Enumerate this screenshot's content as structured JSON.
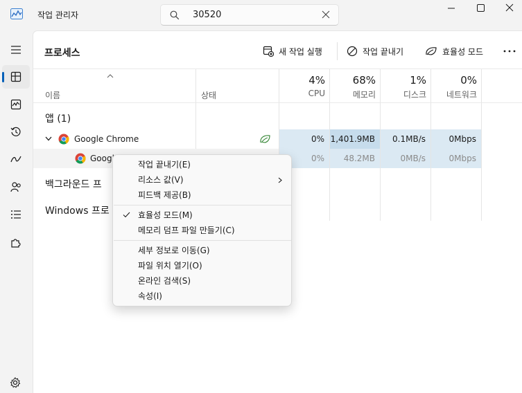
{
  "window": {
    "title": "작업 관리자",
    "search_value": "30520"
  },
  "page": {
    "title": "프로세스"
  },
  "toolbar": {
    "run_new_task": "새 작업 실행",
    "end_task": "작업 끝내기",
    "efficiency_mode": "효율성 모드"
  },
  "columns": {
    "name": "이름",
    "status": "상태",
    "cpu": {
      "percent": "4%",
      "label": "CPU"
    },
    "memory": {
      "percent": "68%",
      "label": "메모리"
    },
    "disk": {
      "percent": "1%",
      "label": "디스크"
    },
    "network": {
      "percent": "0%",
      "label": "네트워크"
    }
  },
  "groups": {
    "apps": "앱 (1)",
    "background": "백그라운드 프",
    "windows": "Windows 프로"
  },
  "rows": [
    {
      "name": "Google Chrome",
      "cpu": "0%",
      "memory": "1,401.9MB",
      "disk": "0.1MB/s",
      "network": "0Mbps"
    },
    {
      "name": "Googl",
      "cpu": "0%",
      "memory": "48.2MB",
      "disk": "0MB/s",
      "network": "0Mbps"
    }
  ],
  "context_menu": {
    "end_task": "작업 끝내기(E)",
    "resource_values": "리소스 값(V)",
    "feedback": "피드백 제공(B)",
    "efficiency_mode": "효율성 모드(M)",
    "memory_dump": "메모리 덤프 파일 만들기(C)",
    "go_to_details": "세부 정보로 이동(G)",
    "open_file_location": "파일 위치 열기(O)",
    "search_online": "온라인 검색(S)",
    "properties": "속성(I)"
  },
  "colors": {
    "accent": "#005fb8",
    "highlight": "#dbe9f3",
    "highlight_strong": "#c6dcec"
  }
}
